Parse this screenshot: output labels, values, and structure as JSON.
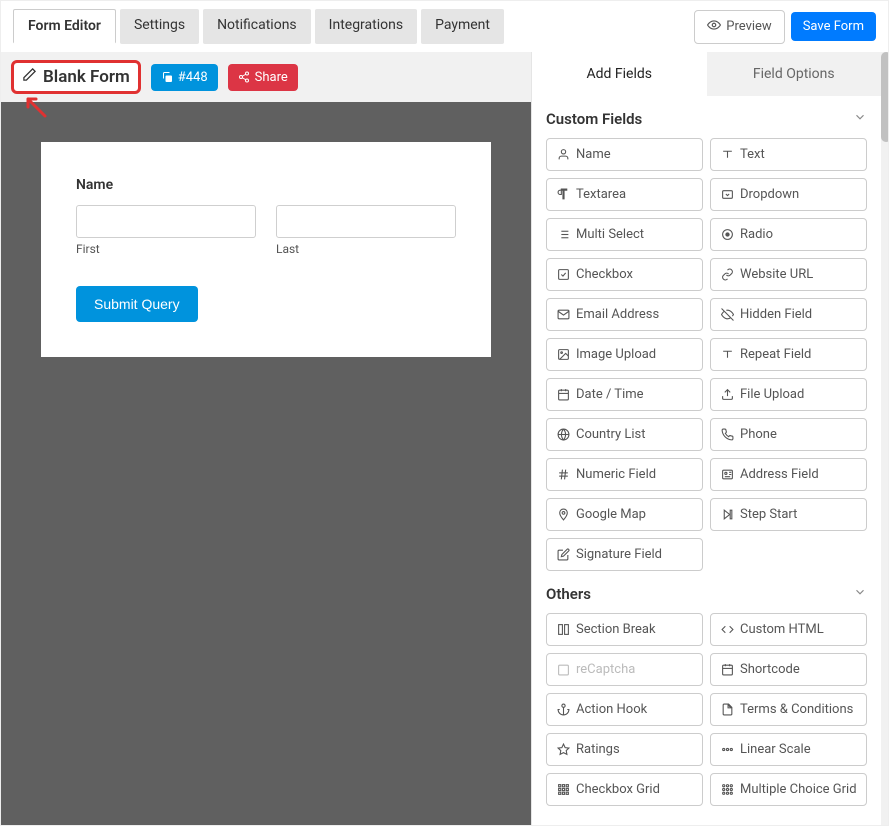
{
  "topTabs": [
    "Form Editor",
    "Settings",
    "Notifications",
    "Integrations",
    "Payment"
  ],
  "activeTopTab": 0,
  "previewLabel": "Preview",
  "saveLabel": "Save Form",
  "formTitle": "Blank Form",
  "idBadge": "#448",
  "shareLabel": "Share",
  "form": {
    "nameLabel": "Name",
    "firstLabel": "First",
    "lastLabel": "Last",
    "submitLabel": "Submit Query"
  },
  "sideTabs": [
    "Add Fields",
    "Field Options"
  ],
  "activeSideTab": 0,
  "sections": [
    {
      "title": "Custom Fields",
      "items": [
        {
          "icon": "user",
          "label": "Name"
        },
        {
          "icon": "text",
          "label": "Text"
        },
        {
          "icon": "para",
          "label": "Textarea"
        },
        {
          "icon": "caretbox",
          "label": "Dropdown"
        },
        {
          "icon": "list",
          "label": "Multi Select"
        },
        {
          "icon": "radio",
          "label": "Radio"
        },
        {
          "icon": "check",
          "label": "Checkbox"
        },
        {
          "icon": "link",
          "label": "Website URL"
        },
        {
          "icon": "mail",
          "label": "Email Address"
        },
        {
          "icon": "hidden",
          "label": "Hidden Field"
        },
        {
          "icon": "img",
          "label": "Image Upload"
        },
        {
          "icon": "repeat",
          "label": "Repeat Field"
        },
        {
          "icon": "cal",
          "label": "Date / Time"
        },
        {
          "icon": "upload",
          "label": "File Upload"
        },
        {
          "icon": "globe",
          "label": "Country List"
        },
        {
          "icon": "phone",
          "label": "Phone"
        },
        {
          "icon": "hash",
          "label": "Numeric Field"
        },
        {
          "icon": "address",
          "label": "Address Field"
        },
        {
          "icon": "pin",
          "label": "Google Map"
        },
        {
          "icon": "step",
          "label": "Step Start"
        },
        {
          "icon": "edit",
          "label": "Signature Field"
        }
      ]
    },
    {
      "title": "Others",
      "items": [
        {
          "icon": "cols",
          "label": "Section Break"
        },
        {
          "icon": "code",
          "label": "Custom HTML"
        },
        {
          "icon": "recap",
          "label": "reCaptcha",
          "disabled": true
        },
        {
          "icon": "cal",
          "label": "Shortcode"
        },
        {
          "icon": "anchor",
          "label": "Action Hook"
        },
        {
          "icon": "file",
          "label": "Terms & Conditions"
        },
        {
          "icon": "star",
          "label": "Ratings"
        },
        {
          "icon": "linear",
          "label": "Linear Scale"
        },
        {
          "icon": "gridc",
          "label": "Checkbox Grid"
        },
        {
          "icon": "gridr",
          "label": "Multiple Choice Grid"
        }
      ]
    }
  ]
}
